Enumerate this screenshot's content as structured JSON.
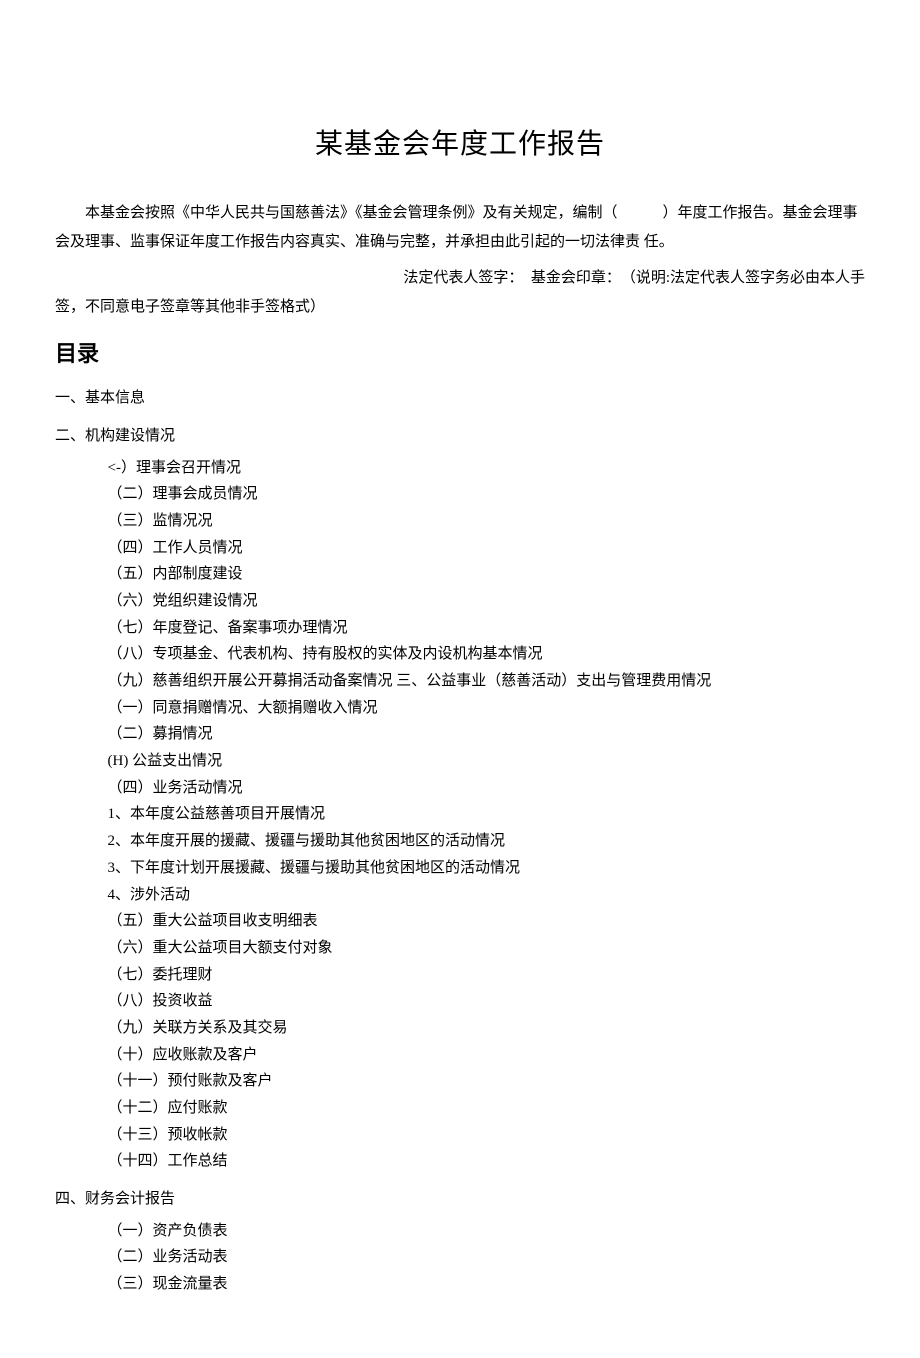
{
  "title": "某基金会年度工作报告",
  "intro_p1": "本基金会按照《中华人民共与国慈善法》《基金会管理条例》及有关规定，编制（　　　）年度工作报告。基金会理事会及理事、监事保证年度工作报告内容真实、准确与完整，并承担由此引起的一切法律责 任。",
  "signature_right": "法定代表人签字：　基金会印章：　（说明:法定代表人签字务必由本人手",
  "signature_left": "签，不同意电子签章等其他非手签格式）",
  "toc_heading": "目录",
  "sections": [
    {
      "heading": "一、基本信息",
      "items": []
    },
    {
      "heading": "二、机构建设情况",
      "items": [
        "<-）理事会召开情况",
        "（二）理事会成员情况",
        "（三）监情况况",
        "（四）工作人员情况",
        "（五）内部制度建设",
        "（六）党组织建设情况",
        "（七）年度登记、备案事项办理情况",
        "（八）专项基金、代表机构、持有股权的实体及内设机构基本情况",
        "（九）慈善组织开展公开募捐活动备案情况 三、公益事业（慈善活动）支出与管理费用情况",
        "（一）同意捐赠情况、大额捐赠收入情况",
        "（二）募捐情况",
        "(H) 公益支出情况",
        "（四）业务活动情况",
        "1、本年度公益慈善项目开展情况",
        "2、本年度开展的援藏、援疆与援助其他贫困地区的活动情况",
        "3、下年度计划开展援藏、援疆与援助其他贫困地区的活动情况",
        "4、涉外活动",
        "（五）重大公益项目收支明细表",
        "（六）重大公益项目大额支付对象",
        "（七）委托理财",
        "（八）投资收益",
        "（九）关联方关系及其交易",
        "（十）应收账款及客户",
        "（十一）预付账款及客户",
        "（十二）应付账款",
        "（十三）预收帐款",
        "（十四）工作总结"
      ]
    },
    {
      "heading": "四、财务会计报告",
      "items": [
        "（一）资产负债表",
        "（二）业务活动表",
        "（三）现金流量表"
      ]
    }
  ]
}
